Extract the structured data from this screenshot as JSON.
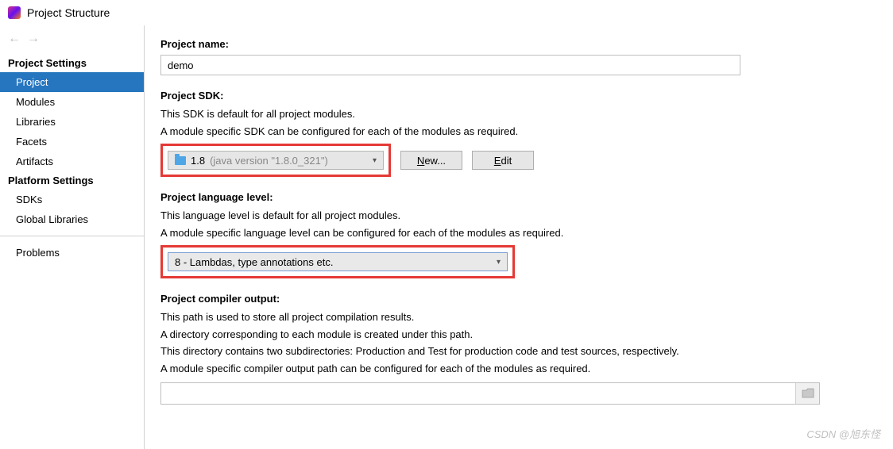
{
  "window": {
    "title": "Project Structure"
  },
  "sidebar": {
    "sections": [
      {
        "heading": "Project Settings",
        "items": [
          {
            "label": "Project",
            "active": true
          },
          {
            "label": "Modules"
          },
          {
            "label": "Libraries"
          },
          {
            "label": "Facets"
          },
          {
            "label": "Artifacts"
          }
        ]
      },
      {
        "heading": "Platform Settings",
        "items": [
          {
            "label": "SDKs"
          },
          {
            "label": "Global Libraries"
          }
        ]
      },
      {
        "heading": "",
        "items": [
          {
            "label": "Problems"
          }
        ]
      }
    ]
  },
  "project_name": {
    "label": "Project name:",
    "value": "demo"
  },
  "project_sdk": {
    "label": "Project SDK:",
    "desc1": "This SDK is default for all project modules.",
    "desc2": "A module specific SDK can be configured for each of the modules as required.",
    "selected_version": "1.8",
    "selected_detail": "(java version \"1.8.0_321\")",
    "new_btn": "New...",
    "edit_btn": "Edit"
  },
  "lang_level": {
    "label": "Project language level:",
    "desc1": "This language level is default for all project modules.",
    "desc2": "A module specific language level can be configured for each of the modules as required.",
    "selected": "8 - Lambdas, type annotations etc."
  },
  "compiler_output": {
    "label": "Project compiler output:",
    "desc1": "This path is used to store all project compilation results.",
    "desc2": "A directory corresponding to each module is created under this path.",
    "desc3": "This directory contains two subdirectories: Production and Test for production code and test sources, respectively.",
    "desc4": "A module specific compiler output path can be configured for each of the modules as required.",
    "value": ""
  },
  "watermark": "CSDN @旭东怪"
}
